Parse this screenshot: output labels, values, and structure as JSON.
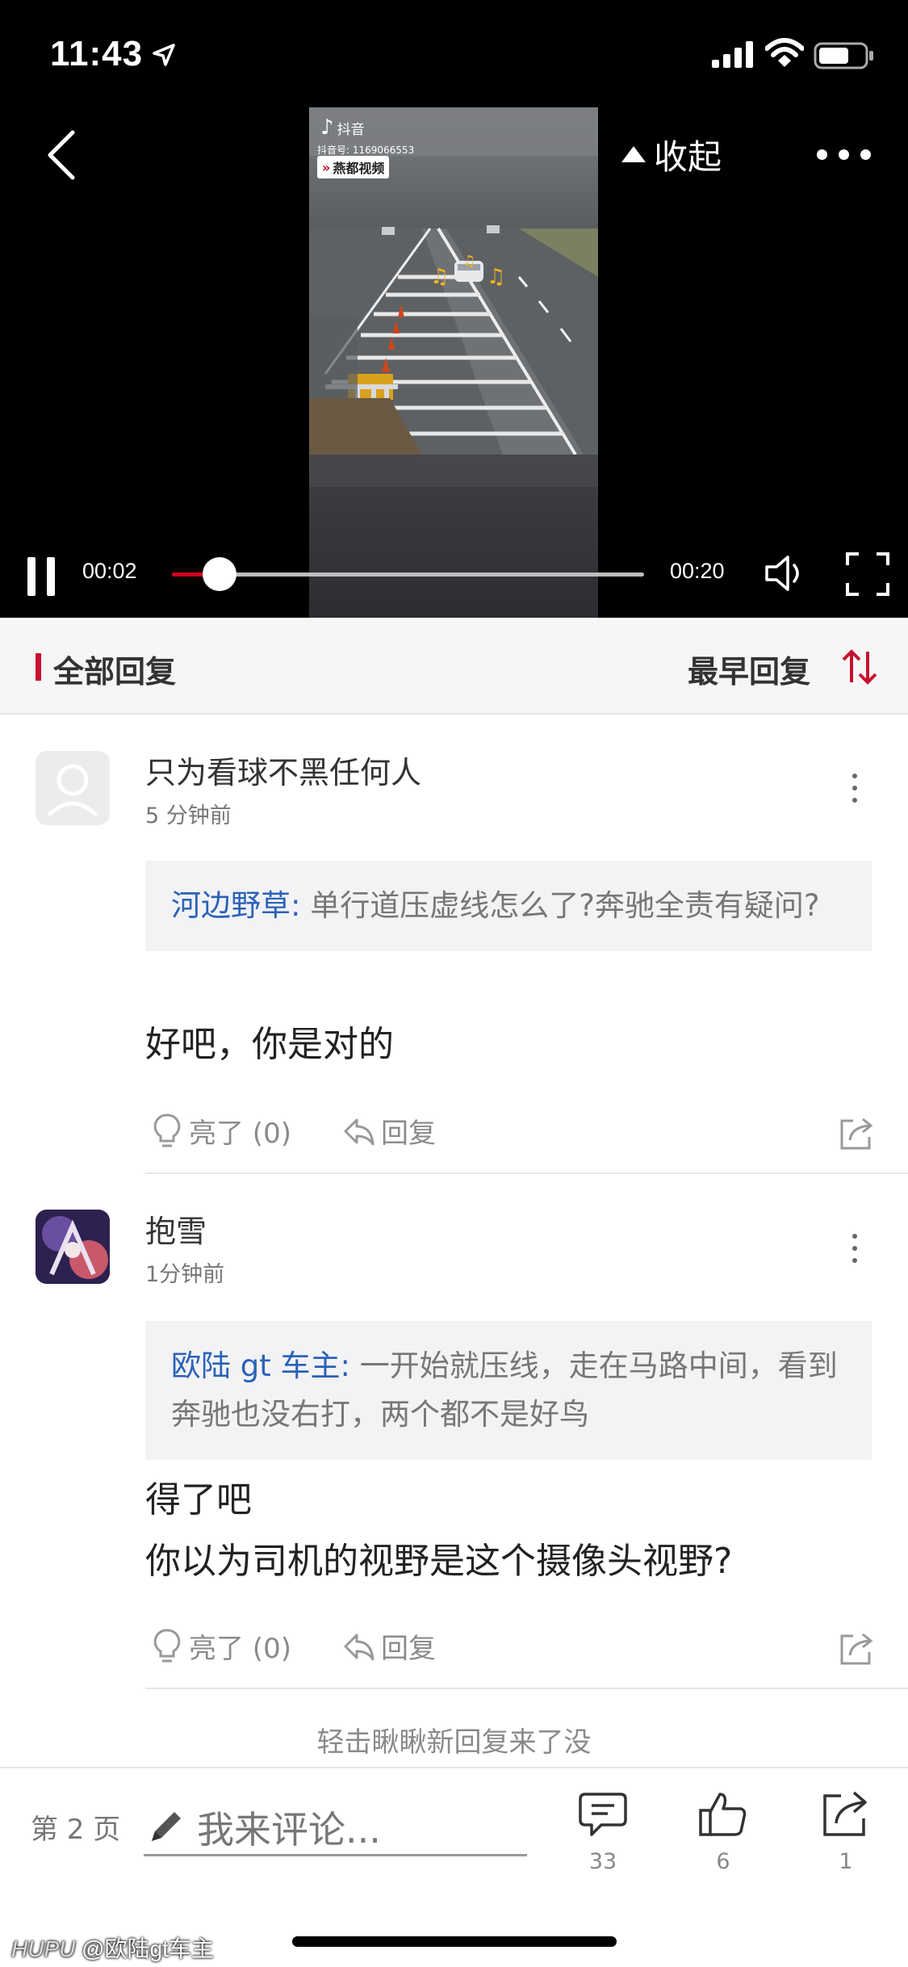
{
  "status_bar": {
    "time": "11:43"
  },
  "video": {
    "collapse_label": "收起",
    "current_time": "00:02",
    "total_time": "00:20",
    "progress": 0.1,
    "thumbnail": {
      "brand": "抖音",
      "account": "抖音号: 1169066553",
      "channel": "燕都视频"
    }
  },
  "reply_header": {
    "all_replies_label": "全部回复",
    "sort_label": "最早回复",
    "accent_color": "#c8102e"
  },
  "comments": [
    {
      "username": "只为看球不黑任何人",
      "time": "5 分钟前",
      "quote_user": "河边野草:",
      "quote_text": "单行道压虚线怎么了?奔驰全责有疑问?",
      "body_lines": [
        "好吧，你是对的"
      ],
      "like_label": "亮了 (0)",
      "reply_label": "回复"
    },
    {
      "username": "抱雪",
      "time": "1分钟前",
      "quote_user": "欧陆 gt 车主:",
      "quote_text": "一开始就压线，走在马路中间，看到奔驰也没右打，两个都不是好鸟",
      "body_lines": [
        "得了吧",
        "你以为司机的视野是这个摄像头视野?"
      ],
      "like_label": "亮了 (0)",
      "reply_label": "回复"
    }
  ],
  "refresh_hint": "轻击瞅瞅新回复来了没",
  "bottom_bar": {
    "page_label": "第 2 页",
    "comment_placeholder": "我来评论...",
    "replies_count": "33",
    "likes_count": "6",
    "shares_count": "1"
  },
  "watermark": {
    "site": "HUPU",
    "handle": "@欧陆gt车主"
  }
}
